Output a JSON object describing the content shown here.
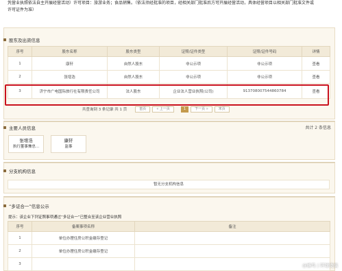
{
  "business_scope": {
    "line1": "凭营业执照依法自主开展经营活动）许可项目：旅游业务；食品销售。（依法须经批准的项目，经相关部门批准后方可开展经营活动，具体经营项目以相关部门批准文件或",
    "line2": "许可证件为准）"
  },
  "shareholders": {
    "title": "股东及出资信息",
    "headers": [
      "序号",
      "股东名称",
      "股东类型",
      "证照/证件类型",
      "证照/证件号码",
      "详情"
    ],
    "rows": [
      {
        "no": "1",
        "name": "康轩",
        "type": "自然人股东",
        "id_type": "非公示项",
        "id_no": "非公示项",
        "detail": "查看"
      },
      {
        "no": "2",
        "name": "张增浩",
        "type": "自然人股东",
        "id_type": "非公示项",
        "id_no": "非公示项",
        "detail": "查看"
      },
      {
        "no": "3",
        "name": "济宁市广电国际旅行社有限责任公司",
        "type": "法人股东",
        "id_type": "企业法人营业执照(公司)",
        "id_no": "913708007544860784",
        "detail": "查看"
      }
    ],
    "pager": {
      "info": "共查询到 3 条记录 共 1 页",
      "first": "首页",
      "prev": "« 上一页",
      "current": "1",
      "next": "下一页 »",
      "last": "末页"
    }
  },
  "key_persons": {
    "title": "主要人员信息",
    "count_text": "共计 2 条信息",
    "people": [
      {
        "name": "张增浩",
        "role": "执行董事兼总..."
      },
      {
        "name": "康轩",
        "role": "监事"
      }
    ]
  },
  "branches": {
    "title": "分支机构信息",
    "empty_text": "暂无分支机构信息"
  },
  "multi_cert": {
    "title": "“多证合一”信息公示",
    "hint": "提示：该企业下列证照事项通过“多证合一”已整合至该企业营业执照",
    "headers": [
      "序号",
      "备案事项名称",
      "备注"
    ],
    "rows": [
      {
        "no": "1",
        "name": "单位办理住房公积金缴存登记",
        "note": ""
      },
      {
        "no": "2",
        "name": "单位办理住房公积金缴存登记",
        "note": ""
      },
      {
        "no": "3",
        "name": "",
        "note": ""
      }
    ]
  },
  "watermark": "@蜂鸟 | 环球烫搞",
  "colors": {
    "accent": "#c49a4c",
    "panel_bg": "#fbf7ee",
    "highlight_border": "#c9101c"
  }
}
